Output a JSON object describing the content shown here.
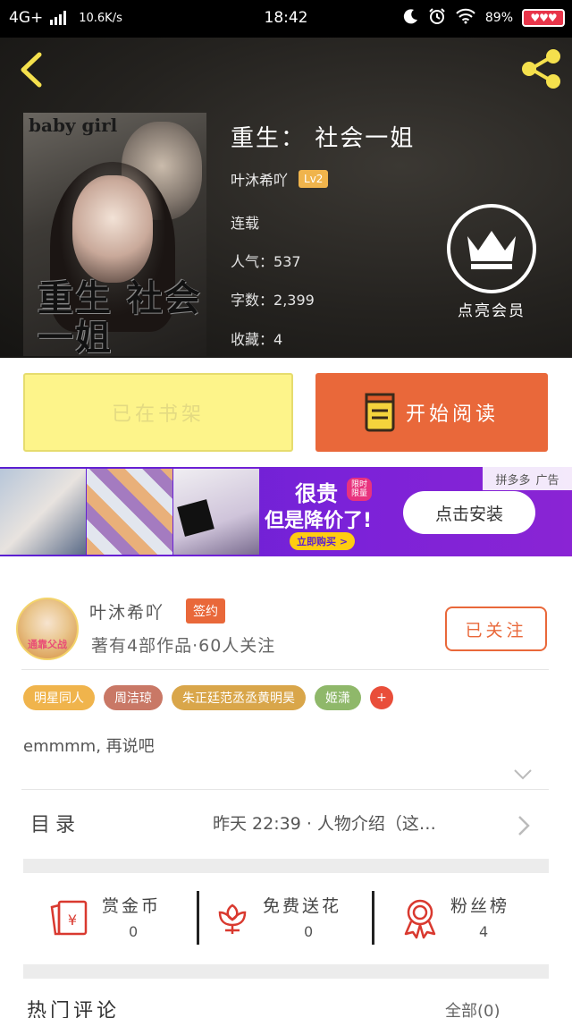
{
  "status_bar": {
    "network": "4G+",
    "speed": "10.6K/s",
    "time": "18:42",
    "battery": "89%"
  },
  "book": {
    "title": "重生： 社会一姐",
    "author": "叶沐希吖",
    "level": "Lv2",
    "status": "连载",
    "popularity_label": "人气：",
    "popularity": "537",
    "words_label": "字数：",
    "words": "2,399",
    "favorites_label": "收藏：",
    "favorites": "4",
    "cover_text_top": "baby girl",
    "cover_text_big": "重生 社会一姐"
  },
  "vip": {
    "label": "点亮会员"
  },
  "actions": {
    "shelf_label": "已在书架",
    "read_label": "开始阅读"
  },
  "ad": {
    "headline1": "很贵",
    "limited_tag": "限时 限量",
    "headline2": "但是降价了!",
    "buy_now": "立即购买 >",
    "install": "点击安装",
    "brand": "拼多多",
    "ad_label": "广告"
  },
  "author": {
    "name": "叶沐希吖",
    "signed_badge": "签约",
    "summary": "著有4部作品·60人关注",
    "follow_label": "已关注",
    "avatar_caption": "通靠父战"
  },
  "tags": [
    {
      "label": "明星同人",
      "color": "#f0b44c"
    },
    {
      "label": "周洁琼",
      "color": "#c97866"
    },
    {
      "label": "朱正廷范丞丞黄明昊",
      "color": "#d9a64a"
    },
    {
      "label": "姬潇",
      "color": "#8fb86a"
    }
  ],
  "tags_more": "+",
  "intro": "emmmm, 再说吧",
  "toc": {
    "label": "目录",
    "latest": "昨天 22:39 · 人物介绍（这…"
  },
  "stats": [
    {
      "label": "赏金币",
      "value": "0"
    },
    {
      "label": "免费送花",
      "value": "0"
    },
    {
      "label": "粉丝榜",
      "value": "4"
    }
  ],
  "comments": {
    "label": "热门评论",
    "all_label": "全部(0)"
  },
  "colors": {
    "accent": "#e9683a",
    "shelf_bg": "#fdf48a",
    "icon_red": "#d9392f"
  }
}
